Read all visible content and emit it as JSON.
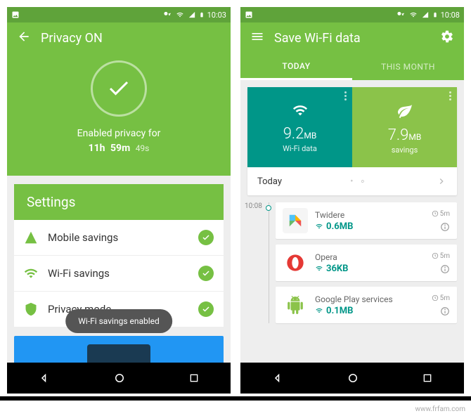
{
  "status": {
    "time": "10:03",
    "time2": "10:08"
  },
  "left": {
    "title": "Privacy ON",
    "hero_line1": "Enabled privacy for",
    "hero_h": "11h",
    "hero_m": "59m",
    "hero_s": "49s",
    "section": "Settings",
    "rows": [
      {
        "label": "Mobile savings"
      },
      {
        "label": "Wi-Fi savings"
      },
      {
        "label": "Privacy mode"
      }
    ],
    "toast": "Wi-Fi savings enabled"
  },
  "right": {
    "title": "Save Wi-Fi data",
    "tabs": {
      "today": "TODAY",
      "month": "THIS MONTH"
    },
    "stats": {
      "wifi_val": "9.2",
      "wifi_unit": "MB",
      "wifi_label": "Wi-Fi data",
      "sav_val": "7.9",
      "sav_unit": "MB",
      "sav_label": "savings"
    },
    "today_label": "Today",
    "time_label": "10:08",
    "apps": [
      {
        "name": "Twidere",
        "data": "0.6MB",
        "dur": "5m"
      },
      {
        "name": "Opera",
        "data": "36KB",
        "dur": "5m"
      },
      {
        "name": "Google Play services",
        "data": "0.1MB",
        "dur": "5m"
      }
    ]
  },
  "watermark": "www.frfam.com"
}
